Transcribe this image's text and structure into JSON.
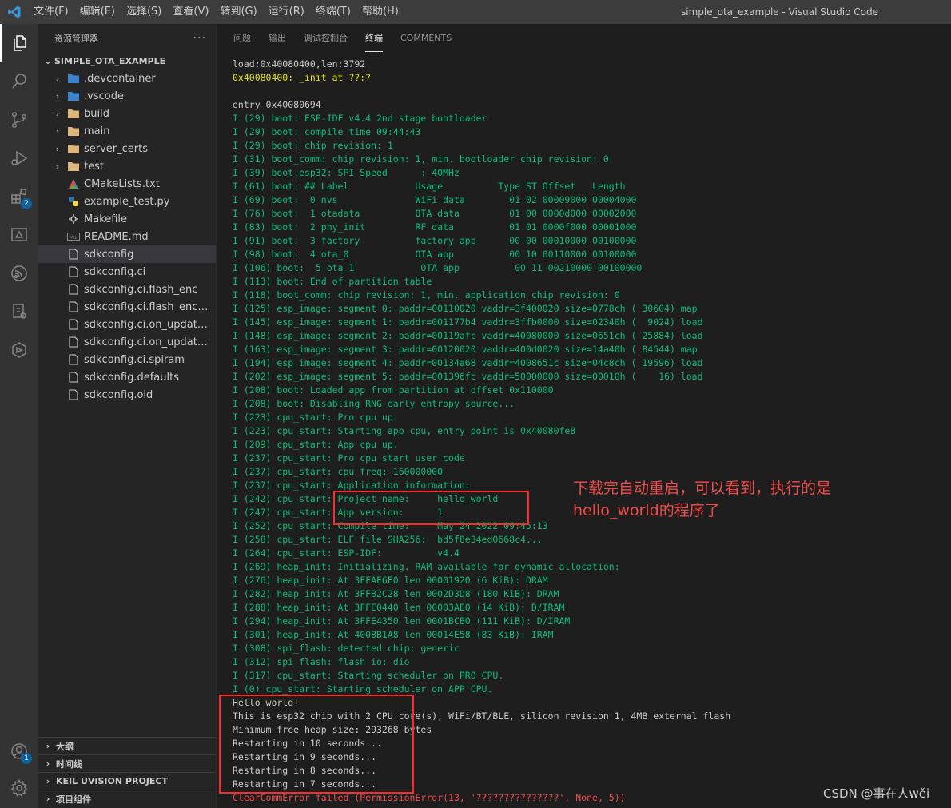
{
  "window": {
    "title": "simple_ota_example - Visual Studio Code",
    "menu": [
      "文件(F)",
      "编辑(E)",
      "选择(S)",
      "查看(V)",
      "转到(G)",
      "运行(R)",
      "终端(T)",
      "帮助(H)"
    ]
  },
  "activity_bar": {
    "items": [
      "files-icon",
      "search-icon",
      "source-control-icon",
      "run-debug-icon",
      "extensions-icon",
      "remote-explorer-icon",
      "espressif-icon",
      "device-icon",
      "container-icon"
    ],
    "extensions_badge": "2",
    "accounts_badge": "1"
  },
  "sidebar": {
    "title": "资源管理器",
    "more": "···",
    "folder": "SIMPLE_OTA_EXAMPLE",
    "items": [
      {
        "label": ".devcontainer",
        "type": "folder"
      },
      {
        "label": ".vscode",
        "type": "folder"
      },
      {
        "label": "build",
        "type": "folder"
      },
      {
        "label": "main",
        "type": "folder"
      },
      {
        "label": "server_certs",
        "type": "folder"
      },
      {
        "label": "test",
        "type": "folder"
      },
      {
        "label": "CMakeLists.txt",
        "type": "file"
      },
      {
        "label": "example_test.py",
        "type": "file"
      },
      {
        "label": "Makefile",
        "type": "file"
      },
      {
        "label": "README.md",
        "type": "file"
      },
      {
        "label": "sdkconfig",
        "type": "file",
        "selected": true
      },
      {
        "label": "sdkconfig.ci",
        "type": "file"
      },
      {
        "label": "sdkconfig.ci.flash_enc",
        "type": "file"
      },
      {
        "label": "sdkconfig.ci.flash_enc_wifi",
        "type": "file"
      },
      {
        "label": "sdkconfig.ci.on_update_no...",
        "type": "file"
      },
      {
        "label": "sdkconfig.ci.on_update_no...",
        "type": "file"
      },
      {
        "label": "sdkconfig.ci.spiram",
        "type": "file"
      },
      {
        "label": "sdkconfig.defaults",
        "type": "file"
      },
      {
        "label": "sdkconfig.old",
        "type": "file"
      }
    ],
    "sections": [
      "大纲",
      "时间线",
      "KEIL UVISION PROJECT",
      "项目组件"
    ]
  },
  "panel": {
    "tabs": [
      "问题",
      "输出",
      "调试控制台",
      "终端",
      "COMMENTS"
    ],
    "active_tab": "终端"
  },
  "terminal": {
    "lines": [
      {
        "t": "load:0x40080400,len:3792",
        "c": "white"
      },
      {
        "t": "0x40080400: _init at ??:?",
        "c": "yellow"
      },
      {
        "t": "",
        "c": "white"
      },
      {
        "t": "entry 0x40080694",
        "c": "white"
      },
      {
        "t": "I (29) boot: ESP-IDF v4.4 2nd stage bootloader",
        "c": "green"
      },
      {
        "t": "I (29) boot: compile time 09:44:43",
        "c": "green"
      },
      {
        "t": "I (29) boot: chip revision: 1",
        "c": "green"
      },
      {
        "t": "I (31) boot_comm: chip revision: 1, min. bootloader chip revision: 0",
        "c": "green"
      },
      {
        "t": "I (39) boot.esp32: SPI Speed      : 40MHz",
        "c": "green"
      },
      {
        "t": "I (61) boot: ## Label            Usage          Type ST Offset   Length",
        "c": "green"
      },
      {
        "t": "I (69) boot:  0 nvs              WiFi data        01 02 00009000 00004000",
        "c": "green"
      },
      {
        "t": "I (76) boot:  1 otadata          OTA data         01 00 0000d000 00002000",
        "c": "green"
      },
      {
        "t": "I (83) boot:  2 phy_init         RF data          01 01 0000f000 00001000",
        "c": "green"
      },
      {
        "t": "I (91) boot:  3 factory          factory app      00 00 00010000 00100000",
        "c": "green"
      },
      {
        "t": "I (98) boot:  4 ota_0            OTA app          00 10 00110000 00100000",
        "c": "green"
      },
      {
        "t": "I (106) boot:  5 ota_1            OTA app          00 11 00210000 00100000",
        "c": "green"
      },
      {
        "t": "I (113) boot: End of partition table",
        "c": "green"
      },
      {
        "t": "I (118) boot_comm: chip revision: 1, min. application chip revision: 0",
        "c": "green"
      },
      {
        "t": "I (125) esp_image: segment 0: paddr=00110020 vaddr=3f400020 size=0778ch ( 30604) map",
        "c": "green"
      },
      {
        "t": "I (145) esp_image: segment 1: paddr=001177b4 vaddr=3ffb0000 size=02340h (  9024) load",
        "c": "green"
      },
      {
        "t": "I (148) esp_image: segment 2: paddr=00119afc vaddr=40080000 size=0651ch ( 25884) load",
        "c": "green"
      },
      {
        "t": "I (163) esp_image: segment 3: paddr=00120020 vaddr=400d0020 size=14a40h ( 84544) map",
        "c": "green"
      },
      {
        "t": "I (194) esp_image: segment 4: paddr=00134a68 vaddr=4008651c size=04c8ch ( 19596) load",
        "c": "green"
      },
      {
        "t": "I (202) esp_image: segment 5: paddr=001396fc vaddr=50000000 size=00010h (    16) load",
        "c": "green"
      },
      {
        "t": "I (208) boot: Loaded app from partition at offset 0x110000",
        "c": "green"
      },
      {
        "t": "I (208) boot: Disabling RNG early entropy source...",
        "c": "green"
      },
      {
        "t": "I (223) cpu_start: Pro cpu up.",
        "c": "green"
      },
      {
        "t": "I (223) cpu_start: Starting app cpu, entry point is 0x40080fe8",
        "c": "green"
      },
      {
        "t": "I (209) cpu_start: App cpu up.",
        "c": "green"
      },
      {
        "t": "I (237) cpu_start: Pro cpu start user code",
        "c": "green"
      },
      {
        "t": "I (237) cpu_start: cpu freq: 160000000",
        "c": "green"
      },
      {
        "t": "I (237) cpu_start: Application information:",
        "c": "green"
      },
      {
        "t": "I (242) cpu_start: Project name:     hello_world",
        "c": "green"
      },
      {
        "t": "I (247) cpu_start: App version:      1",
        "c": "green"
      },
      {
        "t": "I (252) cpu_start: Compile time:     May 24 2022 09:45:13",
        "c": "green"
      },
      {
        "t": "I (258) cpu_start: ELF file SHA256:  bd5f8e34ed0668c4...",
        "c": "green"
      },
      {
        "t": "I (264) cpu_start: ESP-IDF:          v4.4",
        "c": "green"
      },
      {
        "t": "I (269) heap_init: Initializing. RAM available for dynamic allocation:",
        "c": "green"
      },
      {
        "t": "I (276) heap_init: At 3FFAE6E0 len 00001920 (6 KiB): DRAM",
        "c": "green"
      },
      {
        "t": "I (282) heap_init: At 3FFB2C28 len 0002D3D8 (180 KiB): DRAM",
        "c": "green"
      },
      {
        "t": "I (288) heap_init: At 3FFE0440 len 00003AE0 (14 KiB): D/IRAM",
        "c": "green"
      },
      {
        "t": "I (294) heap_init: At 3FFE4350 len 0001BCB0 (111 KiB): D/IRAM",
        "c": "green"
      },
      {
        "t": "I (301) heap_init: At 4008B1A8 len 00014E58 (83 KiB): IRAM",
        "c": "green"
      },
      {
        "t": "I (308) spi_flash: detected chip: generic",
        "c": "green"
      },
      {
        "t": "I (312) spi_flash: flash io: dio",
        "c": "green"
      },
      {
        "t": "I (317) cpu_start: Starting scheduler on PRO CPU.",
        "c": "green"
      },
      {
        "t": "I (0) cpu_start: Starting scheduler on APP CPU.",
        "c": "green"
      },
      {
        "t": "Hello world!",
        "c": "white"
      },
      {
        "t": "This is esp32 chip with 2 CPU core(s), WiFi/BT/BLE, silicon revision 1, 4MB external flash",
        "c": "white"
      },
      {
        "t": "Minimum free heap size: 293268 bytes",
        "c": "white"
      },
      {
        "t": "Restarting in 10 seconds...",
        "c": "white"
      },
      {
        "t": "Restarting in 9 seconds...",
        "c": "white"
      },
      {
        "t": "Restarting in 8 seconds...",
        "c": "white"
      },
      {
        "t": "Restarting in 7 seconds...",
        "c": "white"
      },
      {
        "t": "ClearCommError failed (PermissionError(13, '???????????????', None, 5))",
        "c": "red"
      }
    ]
  },
  "annotation": {
    "text_line1": "下载完自动重启，可以看到，执行的是",
    "text_line2": "hello_world的程序了",
    "color": "#f14c4c"
  },
  "watermark": "CSDN @事在人wěi"
}
